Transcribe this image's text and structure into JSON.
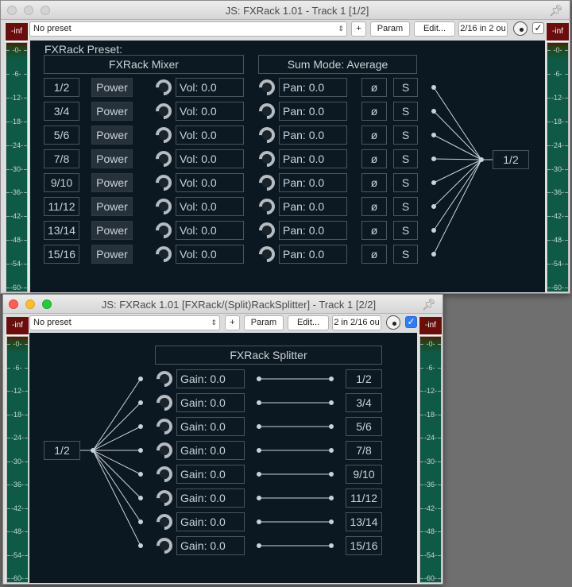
{
  "windows": [
    {
      "title": "JS: FXRack 1.01 - Track 1 [1/2]",
      "preset": "No preset",
      "plus_label": "+",
      "param_label": "Param",
      "edit_label": "Edit...",
      "io_label": "2/16 in 2 ou",
      "checkbox_mark": "✓",
      "meter_head": "-inf",
      "meter_ticks": [
        "-0-",
        "-6-",
        "-12-",
        "-18-",
        "-24-",
        "-30-",
        "-36-",
        "-42-",
        "-48-",
        "-54-",
        "-60-"
      ],
      "preset_label": "FXRack Preset:",
      "mixer_label": "FXRack Mixer",
      "sum_mode_label": "Sum Mode: Average",
      "output_label": "1/2",
      "rows": [
        {
          "pair": "1/2",
          "power": "Power",
          "vol": "Vol: 0.0",
          "pan": "Pan: 0.0",
          "phase": "ø",
          "solo": "S"
        },
        {
          "pair": "3/4",
          "power": "Power",
          "vol": "Vol: 0.0",
          "pan": "Pan: 0.0",
          "phase": "ø",
          "solo": "S"
        },
        {
          "pair": "5/6",
          "power": "Power",
          "vol": "Vol: 0.0",
          "pan": "Pan: 0.0",
          "phase": "ø",
          "solo": "S"
        },
        {
          "pair": "7/8",
          "power": "Power",
          "vol": "Vol: 0.0",
          "pan": "Pan: 0.0",
          "phase": "ø",
          "solo": "S"
        },
        {
          "pair": "9/10",
          "power": "Power",
          "vol": "Vol: 0.0",
          "pan": "Pan: 0.0",
          "phase": "ø",
          "solo": "S"
        },
        {
          "pair": "11/12",
          "power": "Power",
          "vol": "Vol: 0.0",
          "pan": "Pan: 0.0",
          "phase": "ø",
          "solo": "S"
        },
        {
          "pair": "13/14",
          "power": "Power",
          "vol": "Vol: 0.0",
          "pan": "Pan: 0.0",
          "phase": "ø",
          "solo": "S"
        },
        {
          "pair": "15/16",
          "power": "Power",
          "vol": "Vol: 0.0",
          "pan": "Pan: 0.0",
          "phase": "ø",
          "solo": "S"
        }
      ]
    },
    {
      "title": "JS: FXRack 1.01 [FXRack/(Split)RackSplitter] - Track 1 [2/2]",
      "preset": "No preset",
      "plus_label": "+",
      "param_label": "Param",
      "edit_label": "Edit...",
      "io_label": "2 in 2/16 ou",
      "checkbox_mark": "✓",
      "meter_head": "-inf",
      "meter_ticks": [
        "-0-",
        "-6-",
        "-12-",
        "-18-",
        "-24-",
        "-30-",
        "-36-",
        "-42-",
        "-48-",
        "-54-",
        "-60-"
      ],
      "splitter_label": "FXRack Splitter",
      "input_label": "1/2",
      "rows": [
        {
          "gain": "Gain: 0.0",
          "pair": "1/2"
        },
        {
          "gain": "Gain: 0.0",
          "pair": "3/4"
        },
        {
          "gain": "Gain: 0.0",
          "pair": "5/6"
        },
        {
          "gain": "Gain: 0.0",
          "pair": "7/8"
        },
        {
          "gain": "Gain: 0.0",
          "pair": "9/10"
        },
        {
          "gain": "Gain: 0.0",
          "pair": "11/12"
        },
        {
          "gain": "Gain: 0.0",
          "pair": "13/14"
        },
        {
          "gain": "Gain: 0.0",
          "pair": "15/16"
        }
      ]
    }
  ],
  "pin_icon": "pin-icon",
  "colors": {
    "panel_bg": "#0c1821",
    "meter_green": "#0e5a46",
    "meter_red": "#6a0d0d",
    "checkbox_blue": "#2f7df6"
  }
}
